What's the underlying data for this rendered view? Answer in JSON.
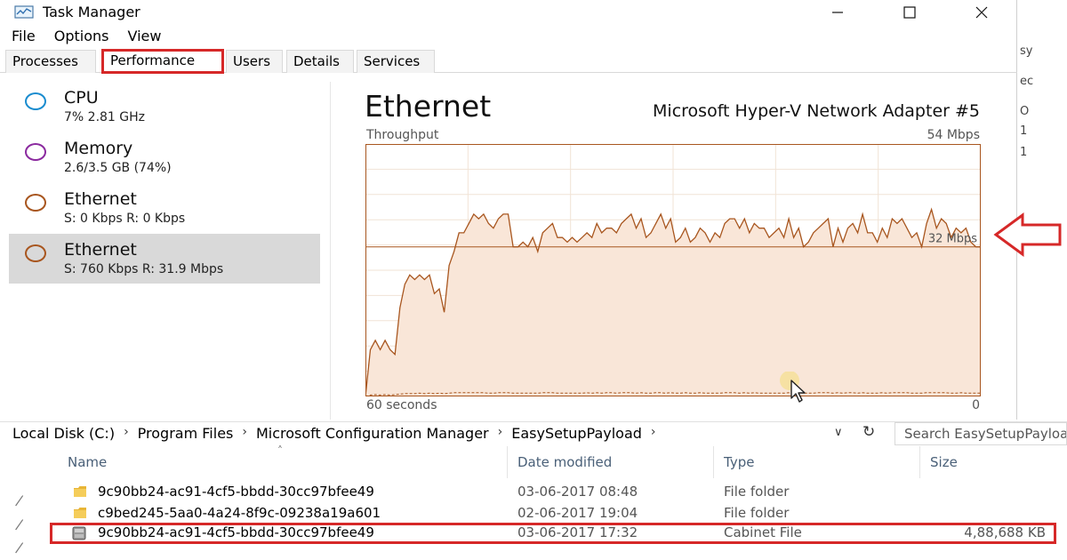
{
  "task_manager": {
    "title": "Task Manager",
    "menu": [
      "File",
      "Options",
      "View"
    ],
    "tabs": [
      "Processes",
      "Performance",
      "Users",
      "Details",
      "Services"
    ],
    "selected_tab": "Performance",
    "sidebar": [
      {
        "title": "CPU",
        "sub": "7% 2.81 GHz",
        "color": "#1a8ccf"
      },
      {
        "title": "Memory",
        "sub": "2.6/3.5 GB (74%)",
        "color": "#8b2a9f"
      },
      {
        "title": "Ethernet",
        "sub": "S: 0 Kbps R: 0 Kbps",
        "color": "#a8561f"
      },
      {
        "title": "Ethernet",
        "sub": "S: 760 Kbps R: 31.9 Mbps",
        "color": "#a8561f",
        "selected": true
      }
    ],
    "panel": {
      "title": "Ethernet",
      "adapter": "Microsoft Hyper-V Network Adapter #5",
      "throughput_label": "Throughput",
      "max_label": "54 Mbps",
      "time_label": "60 seconds",
      "zero_label": "0",
      "current_label": "32 Mbps"
    }
  },
  "chart_data": {
    "type": "area",
    "title": "Throughput",
    "ylim": [
      0,
      54
    ],
    "xlim": [
      60,
      0
    ],
    "grid": true,
    "line_color": "#a8561f",
    "fill_color": "#f9e6d8",
    "receive": [
      0,
      10,
      12,
      10,
      12,
      10,
      9,
      19,
      24,
      26,
      25,
      26,
      25,
      26,
      22,
      23,
      18,
      28,
      31,
      35,
      35,
      37,
      39,
      38,
      39,
      37,
      36,
      38,
      39,
      39,
      32,
      32,
      33,
      32,
      34,
      31,
      35,
      36,
      37,
      34,
      34,
      33,
      34,
      33,
      34,
      35,
      34,
      37,
      35,
      36,
      36,
      35,
      37,
      38,
      39,
      36,
      38,
      34,
      35,
      37,
      39,
      36,
      38,
      33,
      34,
      36,
      33,
      34,
      36,
      35,
      33,
      35,
      34,
      37,
      38,
      38,
      36,
      38,
      35,
      37,
      36,
      36,
      34,
      35,
      36,
      34,
      38,
      34,
      36,
      32,
      33,
      35,
      36,
      37,
      38,
      32,
      36,
      33,
      36,
      37,
      35,
      39,
      35,
      35,
      33,
      36,
      34,
      38,
      37,
      38,
      36,
      34,
      35,
      32,
      37,
      40,
      36,
      38,
      37,
      34,
      36,
      35,
      36,
      33,
      32,
      32
    ],
    "send": [
      0,
      0.3,
      0.4,
      0.3,
      0.4,
      0.3,
      0.4,
      0.5,
      0.6,
      0.6,
      0.6,
      0.7,
      0.6,
      0.7,
      0.6,
      0.7,
      0.6,
      0.7,
      0.8,
      0.8,
      0.8,
      0.8,
      0.8,
      0.8,
      0.8,
      0.7,
      0.7,
      0.8,
      0.8,
      0.8,
      0.7,
      0.7,
      0.7,
      0.7,
      0.7,
      0.7,
      0.8,
      0.8,
      0.8,
      0.7,
      0.7,
      0.7,
      0.7,
      0.7,
      0.7,
      0.8,
      0.7,
      0.8,
      0.7,
      0.8,
      0.8,
      0.7,
      0.8,
      0.8,
      0.8,
      0.7,
      0.8,
      0.7,
      0.7,
      0.8,
      0.8,
      0.7,
      0.8,
      0.7,
      0.7,
      0.8,
      0.7,
      0.7,
      0.8,
      0.7,
      0.7,
      0.7,
      0.7,
      0.8,
      0.8,
      0.8,
      0.7,
      0.8,
      0.7,
      0.8,
      0.7,
      0.7,
      0.7,
      0.7,
      0.7,
      0.7,
      0.8,
      0.7,
      0.8,
      0.7,
      0.7,
      0.7,
      0.8,
      0.8,
      0.8,
      0.7,
      0.8,
      0.7,
      0.8,
      0.8,
      0.7,
      0.8,
      0.7,
      0.7,
      0.7,
      0.8,
      0.7,
      0.8,
      0.8,
      0.8,
      0.8,
      0.7,
      0.7,
      0.7,
      0.8,
      0.8,
      0.8,
      0.8,
      0.8,
      0.7,
      0.7,
      0.8,
      0.7,
      0.7,
      0.7,
      0.7
    ]
  },
  "explorer": {
    "breadcrumb": [
      "Local Disk (C:)",
      "Program Files",
      "Microsoft Configuration Manager",
      "EasySetupPayload"
    ],
    "search_placeholder": "Search EasySetupPayload",
    "columns": [
      "Name",
      "Date modified",
      "Type",
      "Size"
    ],
    "rows": [
      {
        "name": "9c90bb24-ac91-4cf5-bbdd-30cc97bfee49",
        "date": "03-06-2017 08:48",
        "type": "File folder",
        "size": "",
        "icon": "folder-icon"
      },
      {
        "name": "c9bed245-5aa0-4a24-8f9c-09238a19a601",
        "date": "02-06-2017 19:04",
        "type": "File folder",
        "size": "",
        "icon": "folder-icon"
      },
      {
        "name": "9c90bb24-ac91-4cf5-bbdd-30cc97bfee49",
        "date": "03-06-2017 17:32",
        "type": "Cabinet File",
        "size": "4,88,688 KB",
        "icon": "cabinet-file-icon",
        "highlighted": true
      }
    ]
  },
  "background_window_fragments": [
    "sy",
    "ec",
    "O",
    "1",
    "1"
  ]
}
